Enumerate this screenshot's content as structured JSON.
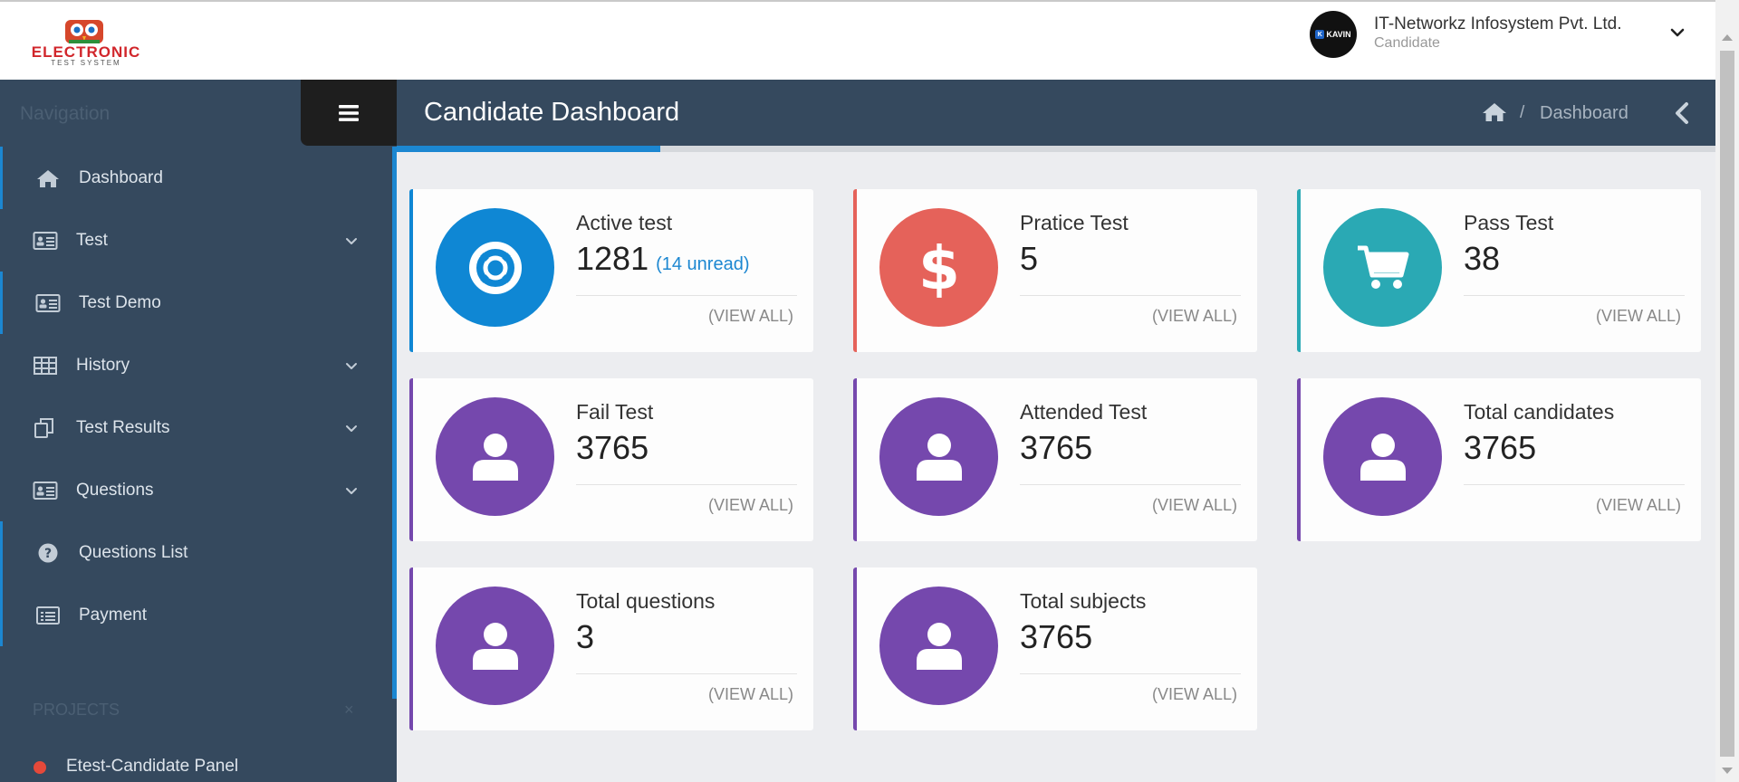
{
  "header": {
    "logo_text": "ELECTRONIC",
    "logo_subtext": "TEST SYSTEM",
    "avatar_text": "KAVIN",
    "user_name": "IT-Networkz Infosystem Pvt. Ltd.",
    "user_role": "Candidate"
  },
  "sidebar": {
    "title": "Navigation",
    "items": [
      {
        "label": "Dashboard",
        "icon": "home-icon",
        "has_caret": false
      },
      {
        "label": "Test",
        "icon": "id-card-icon",
        "has_caret": true
      },
      {
        "label": "Test Demo",
        "icon": "id-card-icon",
        "has_caret": false
      },
      {
        "label": "History",
        "icon": "table-icon",
        "has_caret": true
      },
      {
        "label": "Test Results",
        "icon": "copy-icon",
        "has_caret": true
      },
      {
        "label": "Questions",
        "icon": "id-card-icon",
        "has_caret": true
      },
      {
        "label": "Questions List",
        "icon": "question-circle-icon",
        "has_caret": false
      },
      {
        "label": "Payment",
        "icon": "list-alt-icon",
        "has_caret": false
      }
    ],
    "projects_title": "PROJECTS",
    "projects_close": "×",
    "project_label": "Etest-Candidate Panel"
  },
  "titlebar": {
    "title": "Candidate Dashboard",
    "breadcrumb_separator": "/",
    "breadcrumb_current": "Dashboard",
    "progress_fraction": 0.2
  },
  "cards": [
    {
      "title": "Active test",
      "value": "1281",
      "extra": "(14 unread)",
      "link": "(VIEW ALL)",
      "icon": "life-ring-icon",
      "color": "#0f87d4"
    },
    {
      "title": "Pratice Test",
      "value": "5",
      "extra": "",
      "link": "(VIEW ALL)",
      "icon": "dollar-icon",
      "color": "#e5625a"
    },
    {
      "title": "Pass Test",
      "value": "38",
      "extra": "",
      "link": "(VIEW ALL)",
      "icon": "cart-icon",
      "color": "#2aa9b4"
    },
    {
      "title": "Fail Test",
      "value": "3765",
      "extra": "",
      "link": "(VIEW ALL)",
      "icon": "user-icon",
      "color": "#7548ad"
    },
    {
      "title": "Attended Test",
      "value": "3765",
      "extra": "",
      "link": "(VIEW ALL)",
      "icon": "user-icon",
      "color": "#7548ad"
    },
    {
      "title": "Total candidates",
      "value": "3765",
      "extra": "",
      "link": "(VIEW ALL)",
      "icon": "user-icon",
      "color": "#7548ad"
    },
    {
      "title": "Total questions",
      "value": "3",
      "extra": "",
      "link": "(VIEW ALL)",
      "icon": "user-icon",
      "color": "#7548ad"
    },
    {
      "title": "Total subjects",
      "value": "3765",
      "extra": "",
      "link": "(VIEW ALL)",
      "icon": "user-icon",
      "color": "#7548ad"
    }
  ],
  "colors": {
    "sidebar_bg": "#35495e",
    "accent_blue": "#1c87d1",
    "purple": "#7548ad",
    "red": "#e5625a",
    "teal": "#2aa9b4"
  }
}
